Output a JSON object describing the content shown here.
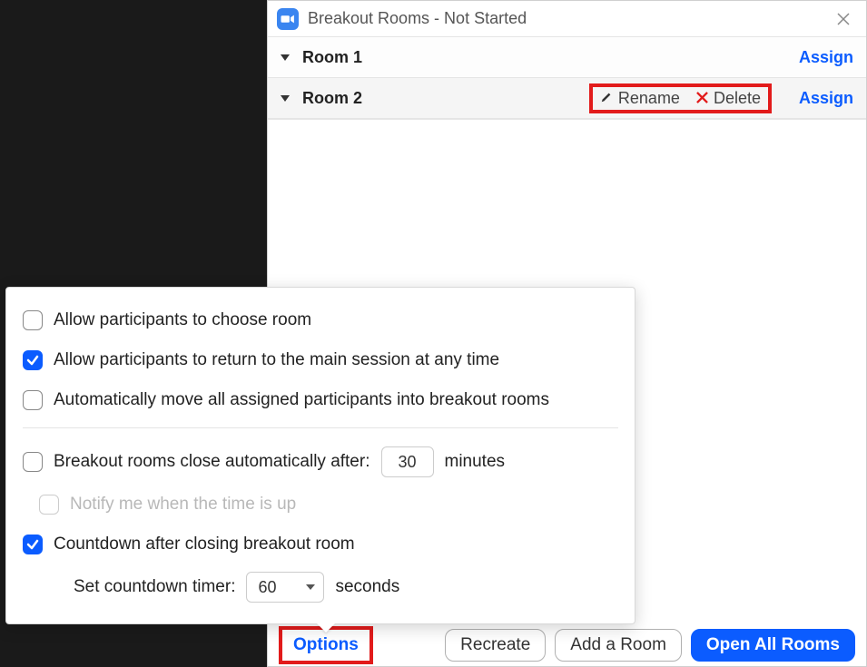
{
  "window": {
    "title": "Breakout Rooms - Not Started"
  },
  "rooms": [
    {
      "name": "Room 1",
      "assign_label": "Assign",
      "hover": false
    },
    {
      "name": "Room 2",
      "assign_label": "Assign",
      "hover": true
    }
  ],
  "row_actions": {
    "rename_label": "Rename",
    "delete_label": "Delete"
  },
  "footer": {
    "options_label": "Options",
    "recreate_label": "Recreate",
    "add_room_label": "Add a Room",
    "open_all_label": "Open All Rooms"
  },
  "options": {
    "choose_room": {
      "label": "Allow participants to choose room",
      "checked": false
    },
    "return_main": {
      "label": "Allow participants to return to the main session at any time",
      "checked": true
    },
    "auto_move": {
      "label": "Automatically move all assigned participants into breakout rooms",
      "checked": false
    },
    "auto_close": {
      "label": "Breakout rooms close automatically after:",
      "checked": false,
      "minutes": "30",
      "minutes_suffix": "minutes"
    },
    "notify": {
      "label": "Notify me when the time is up",
      "checked": false,
      "disabled": true
    },
    "countdown": {
      "label": "Countdown after closing breakout room",
      "checked": true
    },
    "countdown_timer": {
      "label": "Set countdown timer:",
      "value": "60",
      "suffix": "seconds"
    }
  }
}
